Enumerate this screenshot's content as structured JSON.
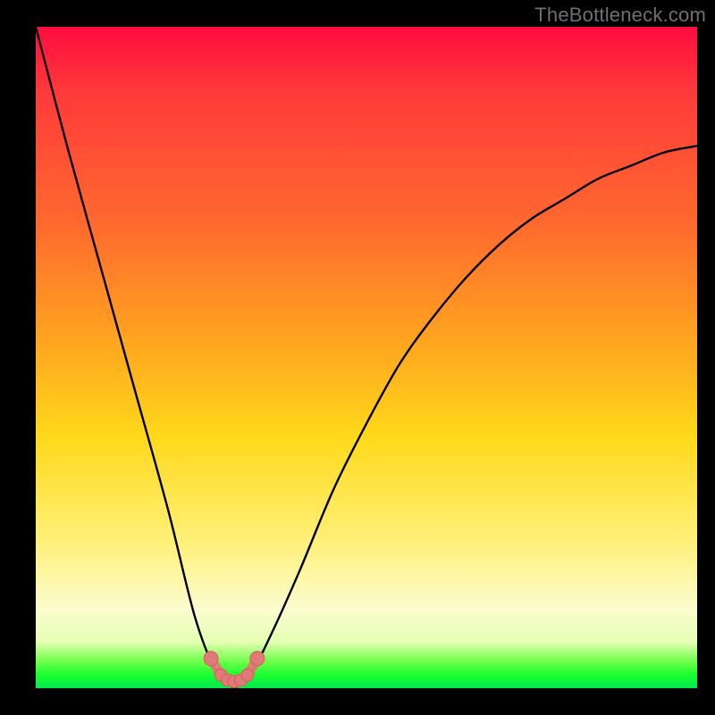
{
  "watermark": "TheBottleneck.com",
  "chart_data": {
    "type": "line",
    "title": "",
    "xlabel": "",
    "ylabel": "",
    "xlim": [
      0,
      100
    ],
    "ylim": [
      0,
      100
    ],
    "series": [
      {
        "name": "bottleneck-curve",
        "x": [
          0,
          5,
          10,
          15,
          20,
          24,
          27,
          29,
          30,
          31,
          33,
          36,
          40,
          45,
          50,
          55,
          60,
          65,
          70,
          75,
          80,
          85,
          90,
          95,
          100
        ],
        "values": [
          100,
          81,
          63,
          45,
          27,
          11,
          3,
          1,
          0,
          1,
          3,
          9,
          18,
          30,
          40,
          49,
          56,
          62,
          67,
          71,
          74,
          77,
          79,
          81,
          82
        ]
      },
      {
        "name": "highlight-dots",
        "x": [
          26.5,
          28,
          29,
          30,
          31,
          32,
          33.5
        ],
        "values": [
          4.5,
          2.0,
          1.2,
          1.0,
          1.2,
          2.0,
          4.5
        ]
      }
    ],
    "colors": {
      "curve": "#000000",
      "dots": "#e07a77",
      "dots_stroke": "#d45f5c"
    }
  }
}
